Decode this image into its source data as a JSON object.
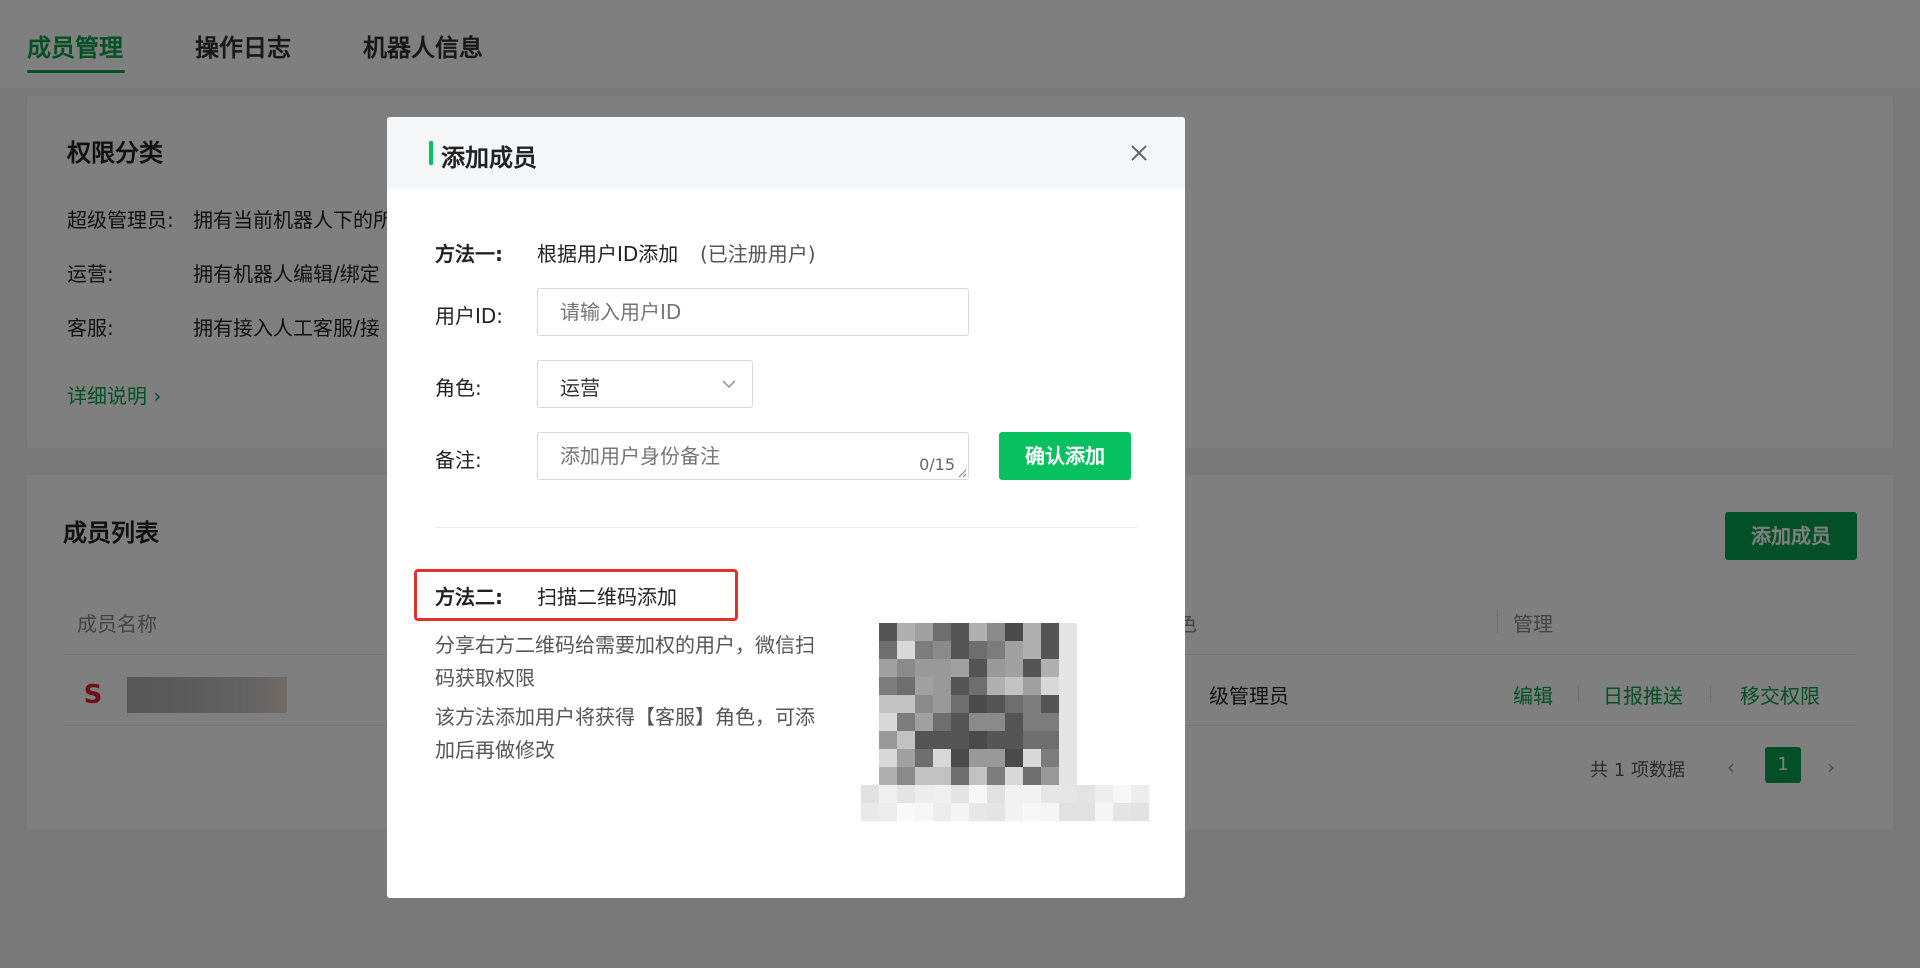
{
  "tabs": [
    {
      "label": "成员管理",
      "active": true
    },
    {
      "label": "操作日志",
      "active": false
    },
    {
      "label": "机器人信息",
      "active": false
    }
  ],
  "permissions": {
    "title": "权限分类",
    "rows": [
      {
        "role": "超级管理员:",
        "desc": "拥有当前机器人下的所"
      },
      {
        "role": "运营:",
        "desc": "拥有机器人编辑/绑定"
      },
      {
        "role": "客服:",
        "desc": "拥有接入人工客服/接"
      }
    ],
    "detail_link": "详细说明 ›"
  },
  "members": {
    "title": "成员列表",
    "add_button": "添加成员",
    "columns": [
      "成员名称",
      "色",
      "管理"
    ],
    "rows": [
      {
        "role": "级管理员",
        "actions": [
          "编辑",
          "日报推送",
          "移交权限"
        ]
      }
    ],
    "pagination": {
      "total_text": "共 1 项数据",
      "current_page": "1",
      "prev": "‹",
      "next": "›"
    }
  },
  "modal": {
    "title": "添加成员",
    "close_icon": "close-icon",
    "method1": {
      "label": "方法一:",
      "text": "根据用户ID添加",
      "hint": "(已注册用户)"
    },
    "user_id": {
      "label": "用户ID:",
      "placeholder": "请输入用户ID",
      "value": ""
    },
    "role": {
      "label": "角色:",
      "value": "运营"
    },
    "remark": {
      "label": "备注:",
      "placeholder": "添加用户身份备注",
      "counter": "0/15"
    },
    "confirm_button": "确认添加",
    "method2": {
      "label": "方法二:",
      "text": "扫描二维码添加",
      "desc1": "分享右方二维码给需要加权的用户，微信扫码获取权限",
      "desc2": "该方法添加用户将获得【客服】角色，可添加后再做修改"
    }
  },
  "colors": {
    "accent": "#07a14e",
    "button_green": "#07c160",
    "highlight_red": "#e0332e",
    "overlay": "rgba(0,0,0,0.5)"
  }
}
